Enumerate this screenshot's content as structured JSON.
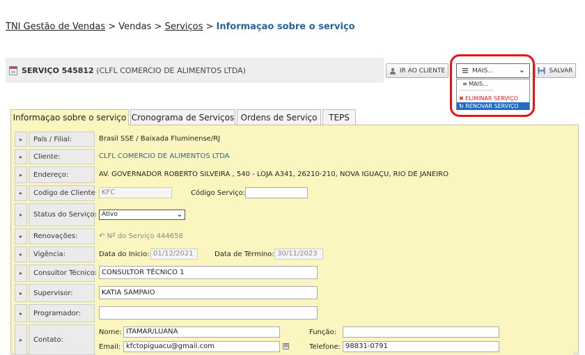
{
  "breadcrumb": {
    "item1": "TNI Gestão de Vendas",
    "sep1": " > ",
    "item2": "Vendas",
    "sep2": " > ",
    "item3": "Serviços",
    "sep3": " > ",
    "current": "Informaçao sobre o serviço"
  },
  "header": {
    "service_label": "SERVIÇO 545812",
    "client_name": "(CLFL COMERCIO DE ALIMENTOS LTDA)"
  },
  "toolbar": {
    "ir_label": "IR AO CLIENTE",
    "mais_label": "MAIS...",
    "salvar_label": "SALVAR"
  },
  "mais_menu": {
    "options": [
      "MAIS...",
      "--------------------",
      "ELIMINAR SERVIÇO",
      "RENOVAR SERVIÇO"
    ],
    "selected": "RENOVAR SERVIÇO"
  },
  "tabs": [
    {
      "label": "Informaçao sobre o serviço",
      "active": true
    },
    {
      "label": "Cronograma de Serviços"
    },
    {
      "label": "Ordens de Serviço"
    },
    {
      "label": "TEPS"
    }
  ],
  "form": {
    "pais": {
      "label": "País / Filial:",
      "value": "Brasil SSE / Baixada Fluminense/RJ"
    },
    "cliente": {
      "label": "Cliente:",
      "value": "CLFL COMERCIO DE ALIMENTOS LTDA"
    },
    "endereco": {
      "label": "Endereço:",
      "value": "AV. GOVERNADOR ROBERTO SILVEIRA , 540 - LOJA A341, 26210-210, NOVA IGUAÇU, RIO DE JANEIRO"
    },
    "codigo_cliente": {
      "label": "Codigo de Cliente:",
      "value": "KFC",
      "servico_label": "Código Serviço:",
      "servico_value": ""
    },
    "status": {
      "label": "Status do Serviço:",
      "value": "Ativo"
    },
    "renovacoes": {
      "label": "Renovações:",
      "value": "↶ Nº do Serviço 444658"
    },
    "vigencia": {
      "label": "Vigência:",
      "inicio_label": "Data do Inicio:",
      "inicio_value": "01/12/2021",
      "termino_label": "Data de Término:",
      "termino_value": "30/11/2023"
    },
    "consultor": {
      "label": "Consultor Técnico:",
      "value": "CONSULTOR TÉCNICO 1"
    },
    "supervisor": {
      "label": "Supervisor:",
      "value": "KATIA SAMPAIO"
    },
    "programador": {
      "label": "Programador:",
      "value": ""
    },
    "contato": {
      "label": "Contato:",
      "nome_label": "Nome:",
      "nome_value": "ITAMAR/LUANA",
      "funcao_label": "Função:",
      "funcao_value": "",
      "email_label": "Email:",
      "email_value": "kfctopiguacu@gmail.com",
      "telefone_label": "Telefone:",
      "telefone_value": "98831-0791"
    }
  },
  "icons": {
    "arrow": "▸",
    "chevron": "⌄"
  },
  "colors": {
    "panel_bg": "#fbf6c0",
    "link": "#2a6496",
    "highlight": "#e11111",
    "selected_option": "#1e6ec8",
    "danger": "#dd2222"
  }
}
